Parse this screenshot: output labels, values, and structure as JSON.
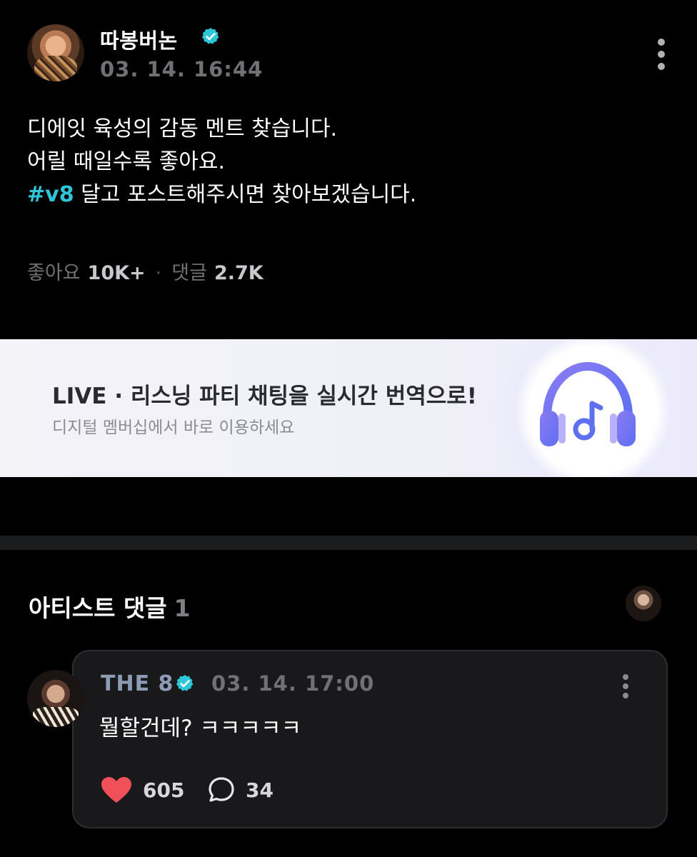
{
  "post": {
    "author": "따봉버논",
    "timestamp": "03. 14. 16:44",
    "lines": [
      "디에잇 육성의 감동 멘트 찾습니다.",
      "어릴 때일수록 좋아요."
    ],
    "hashtag": "#v8",
    "hashtag_line_rest": " 달고 포스트해주시면 찾아보겠습니다.",
    "likes_label": "좋아요",
    "likes_count": "10K+",
    "separator": "·",
    "comments_label": "댓글",
    "comments_count": "2.7K"
  },
  "banner": {
    "title": "LIVE · 리스닝 파티 채팅을 실시간 번역으로!",
    "subtitle": "디지털 멤버십에서 바로 이용하세요",
    "icon": "headphones-music-icon"
  },
  "artist_comments": {
    "title": "아티스트 댓글",
    "count": "1"
  },
  "comment": {
    "author": "THE 8",
    "timestamp": "03. 14. 17:00",
    "text": "뭘할건데? ㅋㅋㅋㅋㅋ",
    "likes": "605",
    "replies": "34"
  },
  "colors": {
    "hashtag": "#2fc5d8",
    "verified": "#2fc5d8",
    "heart": "#f0505a",
    "headphones": "#7b6cf0"
  }
}
